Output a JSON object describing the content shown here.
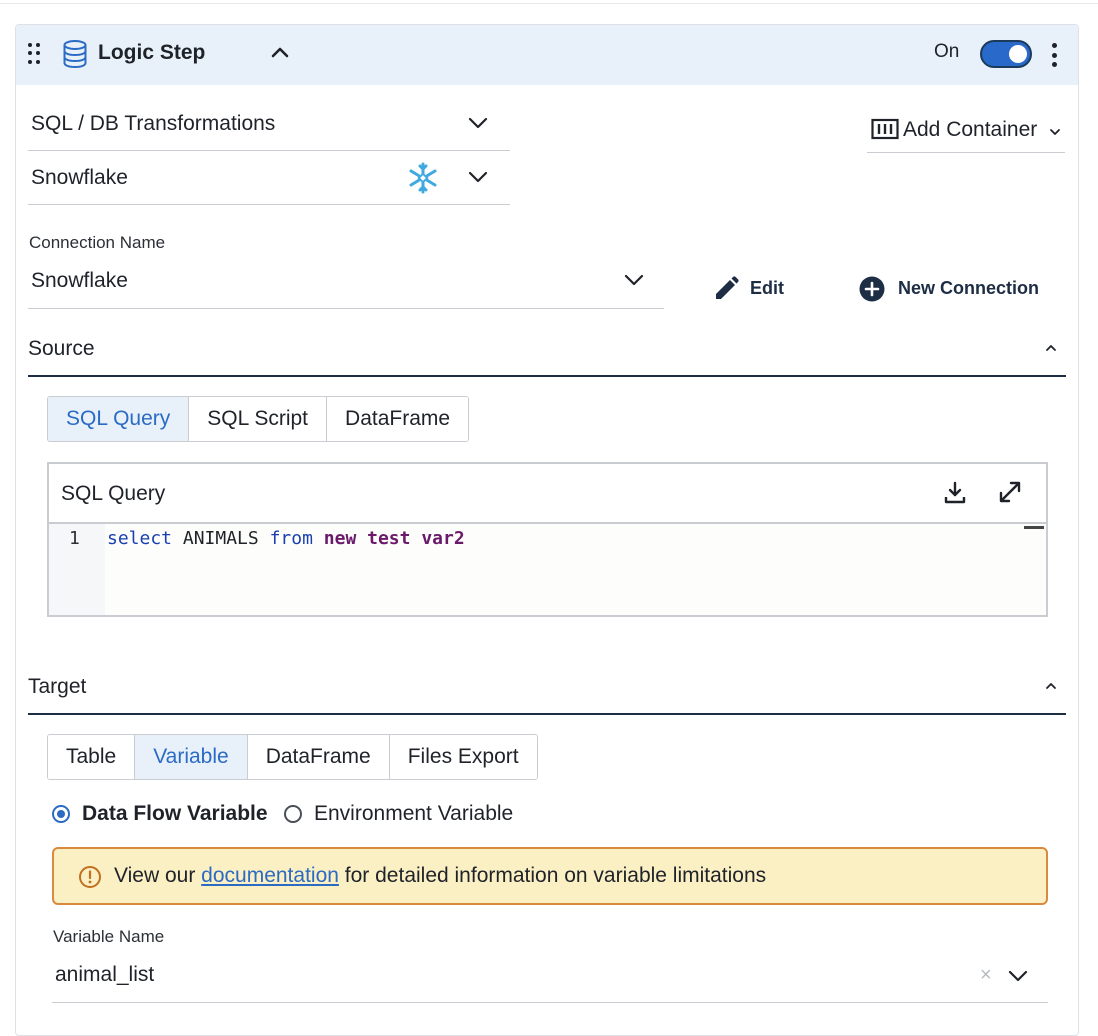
{
  "header": {
    "title": "Logic Step",
    "toggle_label": "On",
    "toggle_on": true,
    "step_icon": "database-icon",
    "collapse_icon": "chevron-up-icon",
    "menu_icon": "kebab-icon",
    "drag_icon": "drag-handle-icon"
  },
  "config": {
    "category_value": "SQL / DB Transformations",
    "database_value": "Snowflake",
    "database_logo": "snowflake-logo",
    "add_container_label": "Add Container"
  },
  "connection": {
    "label": "Connection Name",
    "value": "Snowflake",
    "edit_label": "Edit",
    "new_connection_label": "New Connection"
  },
  "source": {
    "title": "Source",
    "tabs": [
      {
        "label": "SQL Query",
        "active": true
      },
      {
        "label": "SQL Script",
        "active": false
      },
      {
        "label": "DataFrame",
        "active": false
      }
    ],
    "editor": {
      "title": "SQL Query",
      "line_number": "1",
      "code_tokens": [
        {
          "text": "select",
          "style": "kw1"
        },
        {
          "text": " ANIMALS ",
          "style": "plain"
        },
        {
          "text": "from",
          "style": "kw1"
        },
        {
          "text": " ",
          "style": "plain"
        },
        {
          "text": "new test var2",
          "style": "kw2"
        }
      ]
    }
  },
  "target": {
    "title": "Target",
    "tabs": [
      {
        "label": "Table",
        "active": false
      },
      {
        "label": "Variable",
        "active": true
      },
      {
        "label": "DataFrame",
        "active": false
      },
      {
        "label": "Files Export",
        "active": false
      }
    ],
    "radio_options": [
      {
        "label": "Data Flow Variable",
        "checked": true
      },
      {
        "label": "Environment Variable",
        "checked": false
      }
    ],
    "notice": {
      "prefix": "View our",
      "link_text": "documentation",
      "suffix": "for detailed information on variable limitations"
    },
    "variable_name_label": "Variable Name",
    "variable_name_value": "animal_list",
    "clear_glyph": "×"
  },
  "colors": {
    "accent": "#2b6bc4",
    "header_bg": "#e8f1fa",
    "notice_bg": "#fbefc4",
    "notice_border": "#d98a3d",
    "toggle_on": "#2969c9"
  }
}
